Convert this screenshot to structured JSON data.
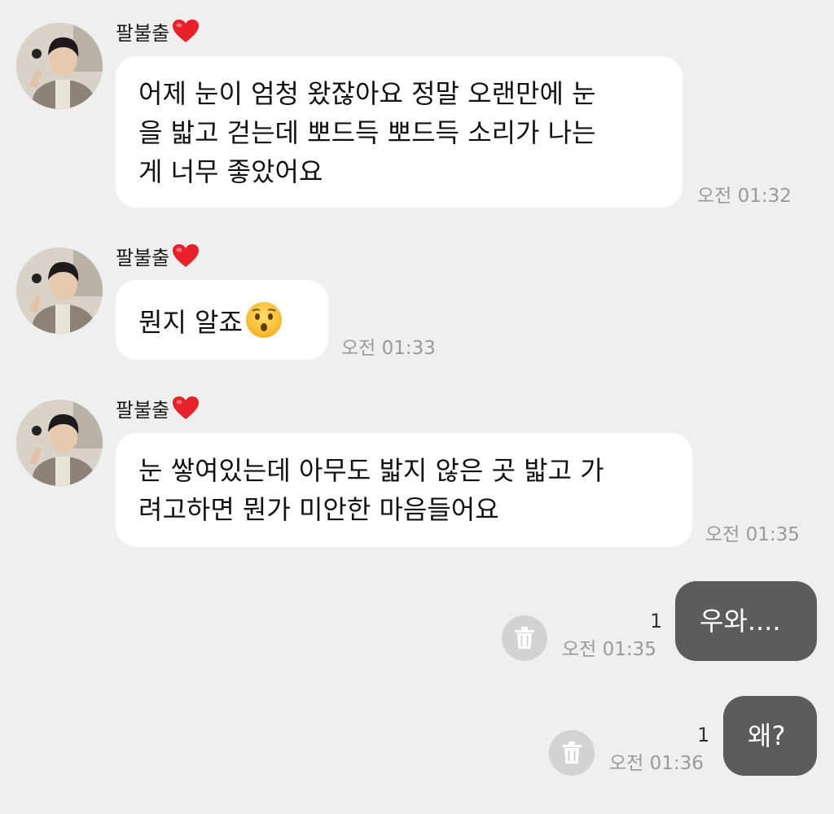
{
  "messages": [
    {
      "sender": "팔불출",
      "sender_suffix_icon": "red-heart",
      "lines": [
        "어제 눈이 엄청 왔잖아요 정말 오랜만에 눈",
        "을 밟고 걷는데 뽀드득 뽀드득 소리가 나는",
        "게 너무 좋았어요"
      ],
      "time": "오전 01:32"
    },
    {
      "sender": "팔불출",
      "sender_suffix_icon": "red-heart",
      "lines": [
        "뭔지 알죠"
      ],
      "emoji": "hushed-face",
      "time": "오전 01:33"
    },
    {
      "sender": "팔불출",
      "sender_suffix_icon": "red-heart",
      "lines": [
        "눈 쌓여있는데 아무도 밟지 않은 곳 밟고 가",
        "려고하면 뭔가 미안한 마음들어요"
      ],
      "time": "오전 01:35"
    },
    {
      "mine": true,
      "lines": [
        "우와...."
      ],
      "unread": "1",
      "time": "오전 01:35",
      "action_icon": "trash-icon"
    },
    {
      "mine": true,
      "lines": [
        "왜?"
      ],
      "unread": "1",
      "time": "오전 01:36",
      "action_icon": "trash-icon"
    }
  ],
  "colors": {
    "background": "#efeff0",
    "incoming_bubble": "#ffffff",
    "outgoing_bubble": "#5c5c5c",
    "timestamp": "#9a9a9a"
  }
}
